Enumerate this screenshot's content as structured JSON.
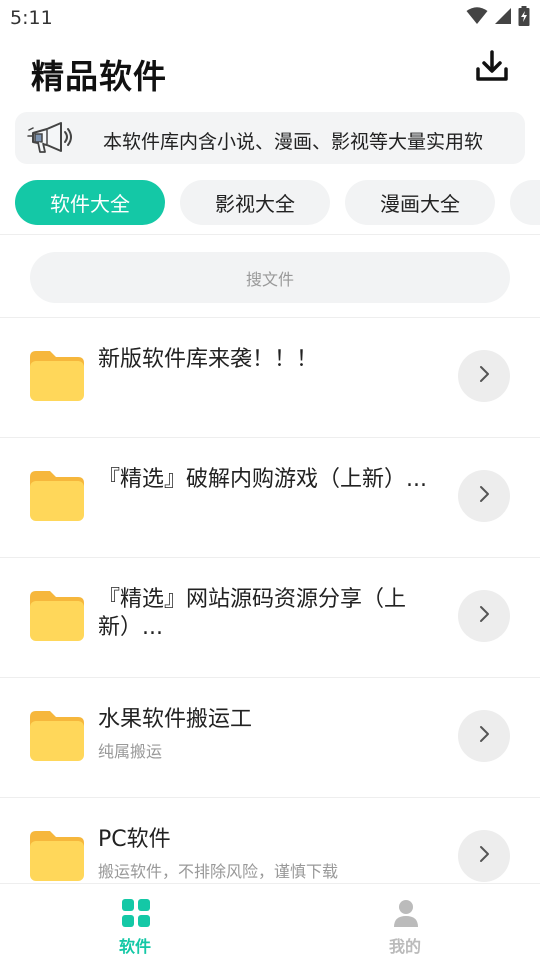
{
  "status_bar": {
    "time": "5:11",
    "icons": [
      "wifi-icon",
      "signal-icon",
      "battery-charging-icon"
    ]
  },
  "header": {
    "title": "精品软件",
    "download_icon": "download-icon"
  },
  "notice": {
    "icon": "megaphone-icon",
    "text": "本软件库内含小说、漫画、影视等大量实用软"
  },
  "tabs": [
    {
      "label": "软件大全",
      "active": true
    },
    {
      "label": "影视大全",
      "active": false
    },
    {
      "label": "漫画大全",
      "active": false
    },
    {
      "label": "",
      "active": false
    }
  ],
  "search": {
    "placeholder": "搜文件"
  },
  "items": [
    {
      "title": "新版软件库来袭！！！",
      "subtitle": ""
    },
    {
      "title": "『精选』破解内购游戏（上新）...",
      "subtitle": ""
    },
    {
      "title": "『精选』网站源码资源分享（上新）...",
      "subtitle": ""
    },
    {
      "title": "水果软件搬运工",
      "subtitle": "纯属搬运"
    },
    {
      "title": "PC软件",
      "subtitle": "搬运软件，不排除风险，谨慎下载"
    }
  ],
  "bottom_nav": [
    {
      "label": "软件",
      "icon": "grid-icon",
      "active": true
    },
    {
      "label": "我的",
      "icon": "person-icon",
      "active": false
    }
  ],
  "colors": {
    "accent": "#14c8a6",
    "folder": "#ffd75a",
    "folder_tab": "#f6b73c",
    "inactive": "#bbbbbb"
  }
}
